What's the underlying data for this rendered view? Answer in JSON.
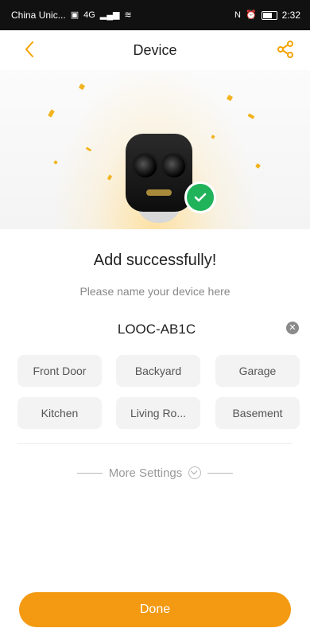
{
  "status_bar": {
    "carrier": "China Unic...",
    "signal_text": "4G",
    "time": "2:32"
  },
  "header": {
    "title": "Device",
    "back_icon": "chevron-left-icon",
    "share_icon": "share-icon"
  },
  "main": {
    "headline": "Add successfully!",
    "subtitle": "Please name your device here",
    "device_name": "LOOC-AB1C",
    "name_suggestions": [
      "Front Door",
      "Backyard",
      "Garage",
      "Kitchen",
      "Living Ro...",
      "Basement"
    ],
    "more_settings_label": "More Settings"
  },
  "footer": {
    "done_label": "Done"
  },
  "colors": {
    "accent": "#f39a12",
    "success": "#21b35a"
  }
}
